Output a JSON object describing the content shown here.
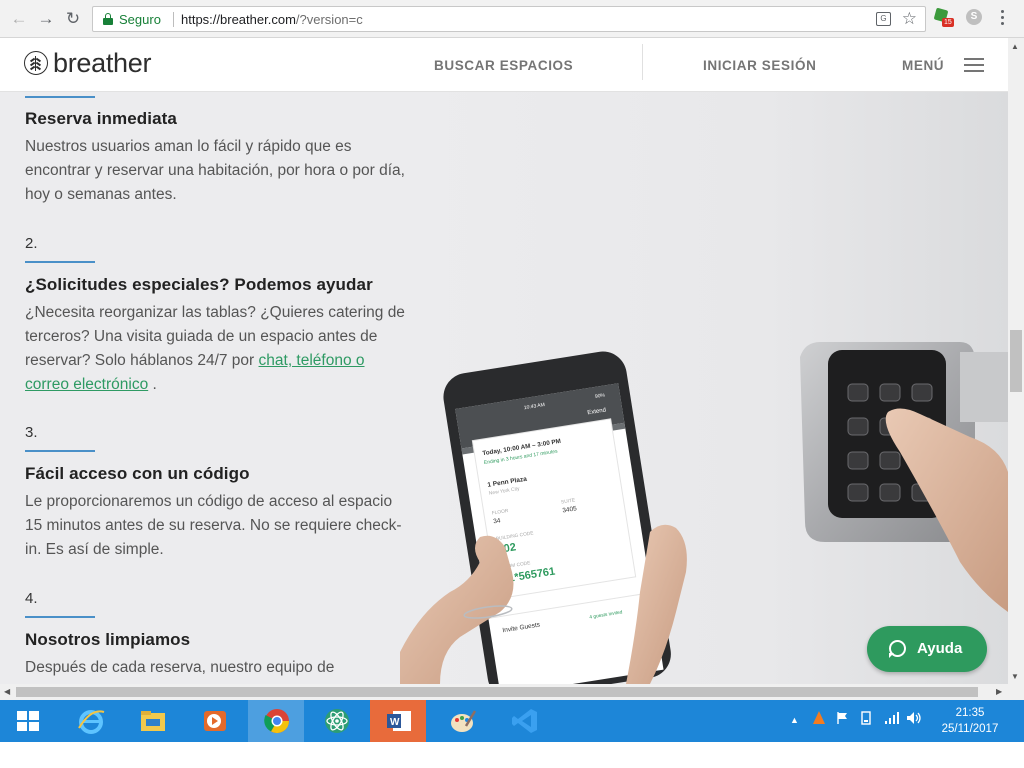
{
  "browser": {
    "secure_label": "Seguro",
    "url_host": "https://breather.com",
    "url_path": "/?version=c",
    "translate_label": "G",
    "extension_badge": "15",
    "skype_label": "S"
  },
  "header": {
    "logo": "breather",
    "nav": {
      "search": "BUSCAR ESPACIOS",
      "login": "INICIAR SESIÓN",
      "menu": "MENÚ"
    }
  },
  "sections": [
    {
      "number": "",
      "title": "Reserva inmediata",
      "body": "Nuestros usuarios aman lo fácil y rápido que es encontrar y reservar una habitación, por hora o por día, hoy o semanas antes."
    },
    {
      "number": "2.",
      "title": "¿Solicitudes especiales? Podemos ayudar",
      "body_before": "¿Necesita reorganizar las tablas? ¿Quieres catering de terceros? Una visita guiada de un espacio antes de reservar? Solo háblanos 24/7 por ",
      "link": "chat, teléfono o correo electrónico",
      "body_after": " ."
    },
    {
      "number": "3.",
      "title": "Fácil acceso con un código",
      "body": "Le proporcionaremos un código de acceso al espacio 15 minutos antes de su reserva. No se requiere check-in. Es así de simple."
    },
    {
      "number": "4.",
      "title": "Nosotros limpiamos",
      "body": "Después de cada reserva, nuestro equipo de"
    }
  ],
  "phone": {
    "status_time": "10:43 AM",
    "battery": "90%",
    "extend": "Extend",
    "booking_time": "Today, 10:00 AM – 3:00 PM",
    "ending": "Ending in 3 hours and 17 minutes",
    "place": "1 Penn Plaza",
    "city": "New York City",
    "floor_label": "FLOOR",
    "floor": "34",
    "suite_label": "SUITE",
    "suite": "3405",
    "building_code_label": "BUILDING CODE",
    "building_code": "202",
    "room_code_label": "ROOM CODE",
    "room_code": "51*565761",
    "invite": "Invite Guests",
    "guests_invited": "4 guests invited"
  },
  "help_button": "Ayuda",
  "taskbar": {
    "time": "21:35",
    "date": "25/11/2017",
    "word_letter": "W"
  },
  "colors": {
    "accent_green": "#2e9a5e",
    "link_green": "#2e9a63",
    "section_rule_blue": "#4a90c8",
    "taskbar_blue": "#1d86d8",
    "secure_green": "#188038"
  }
}
